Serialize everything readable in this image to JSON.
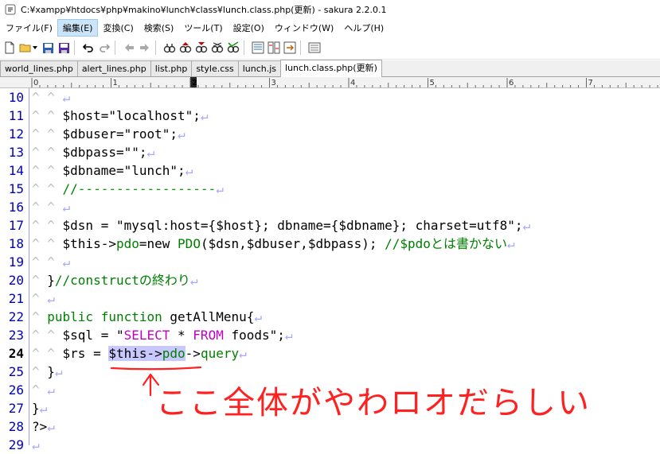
{
  "window": {
    "title": "C:¥xampp¥htdocs¥php¥makino¥lunch¥class¥lunch.class.php(更新) - sakura 2.2.0.1"
  },
  "menu": {
    "items": [
      "ファイル(F)",
      "編集(E)",
      "変換(C)",
      "検索(S)",
      "ツール(T)",
      "設定(O)",
      "ウィンドウ(W)",
      "ヘルプ(H)"
    ]
  },
  "tabs": {
    "items": [
      "world_lines.php",
      "alert_lines.php",
      "list.php",
      "style.css",
      "lunch.js",
      "lunch.class.php(更新)"
    ],
    "active_index": 5
  },
  "ruler": {
    "labels": [
      "0",
      "1",
      "2",
      "3",
      "4",
      "5",
      "6",
      "7"
    ]
  },
  "editor": {
    "current_line": 24,
    "lines": [
      {
        "num": "10",
        "segs": [
          {
            "t": "^ ^ ",
            "c": "tabm"
          },
          {
            "t": "↵",
            "c": "eol"
          }
        ]
      },
      {
        "num": "11",
        "segs": [
          {
            "t": "^ ^ ",
            "c": "tabm"
          },
          {
            "t": "$host=\"localhost\";",
            "c": ""
          },
          {
            "t": "↵",
            "c": "eol"
          }
        ]
      },
      {
        "num": "12",
        "segs": [
          {
            "t": "^ ^ ",
            "c": "tabm"
          },
          {
            "t": "$dbuser=\"root\";",
            "c": ""
          },
          {
            "t": "↵",
            "c": "eol"
          }
        ]
      },
      {
        "num": "13",
        "segs": [
          {
            "t": "^ ^ ",
            "c": "tabm"
          },
          {
            "t": "$dbpass=\"\";",
            "c": ""
          },
          {
            "t": "↵",
            "c": "eol"
          }
        ]
      },
      {
        "num": "14",
        "segs": [
          {
            "t": "^ ^ ",
            "c": "tabm"
          },
          {
            "t": "$dbname=\"lunch\";",
            "c": ""
          },
          {
            "t": "↵",
            "c": "eol"
          }
        ]
      },
      {
        "num": "15",
        "segs": [
          {
            "t": "^ ^ ",
            "c": "tabm"
          },
          {
            "t": "//",
            "c": "cm"
          },
          {
            "t": "------------------",
            "c": "dash"
          },
          {
            "t": "↵",
            "c": "eol"
          }
        ]
      },
      {
        "num": "16",
        "segs": [
          {
            "t": "^ ^ ",
            "c": "tabm"
          },
          {
            "t": "↵",
            "c": "eol"
          }
        ]
      },
      {
        "num": "17",
        "segs": [
          {
            "t": "^ ^ ",
            "c": "tabm"
          },
          {
            "t": "$dsn = \"mysql:host={$host}; dbname={$dbname}; charset=utf8\";",
            "c": ""
          },
          {
            "t": "↵",
            "c": "eol"
          }
        ]
      },
      {
        "num": "18",
        "segs": [
          {
            "t": "^ ^ ",
            "c": "tabm"
          },
          {
            "t": "$this->",
            "c": ""
          },
          {
            "t": "pdo",
            "c": "kw"
          },
          {
            "t": "=new ",
            "c": ""
          },
          {
            "t": "PDO",
            "c": "kw"
          },
          {
            "t": "($dsn,$dbuser,$dbpass); ",
            "c": ""
          },
          {
            "t": "//$pdoとは書かない",
            "c": "cm"
          },
          {
            "t": "↵",
            "c": "eol"
          }
        ]
      },
      {
        "num": "19",
        "segs": [
          {
            "t": "^ ^ ",
            "c": "tabm"
          },
          {
            "t": "↵",
            "c": "eol"
          }
        ]
      },
      {
        "num": "20",
        "segs": [
          {
            "t": "^ ",
            "c": "tabm"
          },
          {
            "t": "}",
            "c": ""
          },
          {
            "t": "//constructの終わり",
            "c": "cm"
          },
          {
            "t": "↵",
            "c": "eol"
          }
        ]
      },
      {
        "num": "21",
        "segs": [
          {
            "t": "^ ",
            "c": "tabm"
          },
          {
            "t": "↵",
            "c": "eol"
          }
        ]
      },
      {
        "num": "22",
        "segs": [
          {
            "t": "^ ",
            "c": "tabm"
          },
          {
            "t": "public",
            "c": "kw"
          },
          {
            "t": " ",
            "c": ""
          },
          {
            "t": "function",
            "c": "kw"
          },
          {
            "t": " getAllMenu{",
            "c": ""
          },
          {
            "t": "↵",
            "c": "eol"
          }
        ]
      },
      {
        "num": "23",
        "segs": [
          {
            "t": "^ ^ ",
            "c": "tabm"
          },
          {
            "t": "$sql = \"",
            "c": ""
          },
          {
            "t": "SELECT",
            "c": "sql"
          },
          {
            "t": " * ",
            "c": ""
          },
          {
            "t": "FROM",
            "c": "sql"
          },
          {
            "t": " foods\";",
            "c": ""
          },
          {
            "t": "↵",
            "c": "eol"
          }
        ]
      },
      {
        "num": "24",
        "segs": [
          {
            "t": "^ ^ ",
            "c": "tabm"
          },
          {
            "t": "$rs = ",
            "c": ""
          },
          {
            "t": "$this->",
            "c": "sel"
          },
          {
            "t": "pdo",
            "c": "sel kw"
          },
          {
            "t": "->",
            "c": ""
          },
          {
            "t": "query",
            "c": "kw"
          },
          {
            "t": "↵",
            "c": "eol"
          }
        ]
      },
      {
        "num": "25",
        "segs": [
          {
            "t": "^ ",
            "c": "tabm"
          },
          {
            "t": "}",
            "c": ""
          },
          {
            "t": "↵",
            "c": "eol"
          }
        ]
      },
      {
        "num": "26",
        "segs": [
          {
            "t": "^ ",
            "c": "tabm"
          },
          {
            "t": "↵",
            "c": "eol"
          }
        ]
      },
      {
        "num": "27",
        "segs": [
          {
            "t": "}",
            "c": ""
          },
          {
            "t": "↵",
            "c": "eol"
          }
        ]
      },
      {
        "num": "28",
        "segs": [
          {
            "t": "?>",
            "c": ""
          },
          {
            "t": "↵",
            "c": "eol"
          }
        ]
      },
      {
        "num": "29",
        "segs": [
          {
            "t": "↵",
            "c": "eol"
          }
        ]
      }
    ]
  },
  "annotation": {
    "text": "ここ全体がやわロオだらしい",
    "color": "#ff2020"
  }
}
